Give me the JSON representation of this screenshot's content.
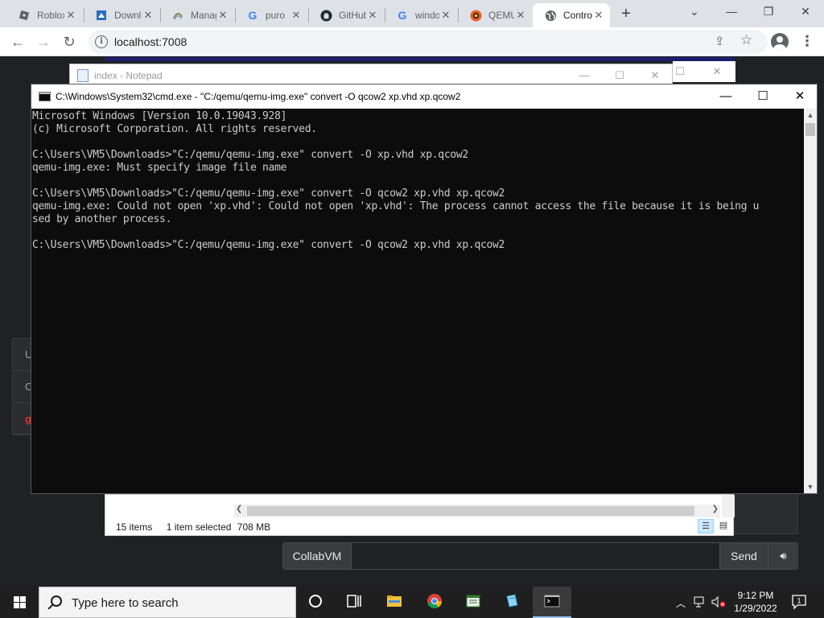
{
  "browser": {
    "tabs": [
      {
        "title": "Roblox",
        "icon": "roblox-icon",
        "active": false
      },
      {
        "title": "Download",
        "icon": "download-site-icon",
        "active": false
      },
      {
        "title": "Manage",
        "icon": "manage-icon",
        "active": false
      },
      {
        "title": "puro",
        "icon": "google-icon",
        "active": false
      },
      {
        "title": "GitHub",
        "icon": "github-icon",
        "active": false
      },
      {
        "title": "windows",
        "icon": "google-icon",
        "active": false
      },
      {
        "title": "QEMU",
        "icon": "qemu-icon",
        "active": false
      },
      {
        "title": "Control",
        "icon": "globe-icon",
        "active": true
      }
    ],
    "url": "localhost:7008"
  },
  "notepad": {
    "title": "index - Notepad"
  },
  "cmd": {
    "title": "C:\\Windows\\System32\\cmd.exe - \"C:/qemu/qemu-img.exe\"  convert -O qcow2 xp.vhd xp.qcow2",
    "lines": [
      "Microsoft Windows [Version 10.0.19043.928]",
      "(c) Microsoft Corporation. All rights reserved.",
      "",
      "C:\\Users\\VM5\\Downloads>\"C:/qemu/qemu-img.exe\" convert -O xp.vhd xp.qcow2",
      "qemu-img.exe: Must specify image file name",
      "",
      "C:\\Users\\VM5\\Downloads>\"C:/qemu/qemu-img.exe\" convert -O qcow2 xp.vhd xp.qcow2",
      "qemu-img.exe: Could not open 'xp.vhd': Could not open 'xp.vhd': The process cannot access the file because it is being u",
      "sed by another process.",
      "",
      "C:\\Users\\VM5\\Downloads>\"C:/qemu/qemu-img.exe\" convert -O qcow2 xp.vhd xp.qcow2"
    ]
  },
  "explorer": {
    "item_count": "15 items",
    "selection": "1 item selected",
    "selection_size": "708 MB"
  },
  "collabvm": {
    "username": "CollabVM",
    "chat_placeholder": "",
    "send_label": "Send",
    "user_panel_letters": [
      "U",
      "C",
      "g"
    ]
  },
  "taskbar": {
    "search_placeholder": "Type here to search",
    "time": "9:12 PM",
    "date": "1/29/2022",
    "notification_count": "1"
  },
  "colors": {
    "console_bg": "#0c0c0c",
    "console_fg": "#cccccc",
    "taskbar_bg": "#1f1f1f",
    "page_bg": "#202124"
  }
}
